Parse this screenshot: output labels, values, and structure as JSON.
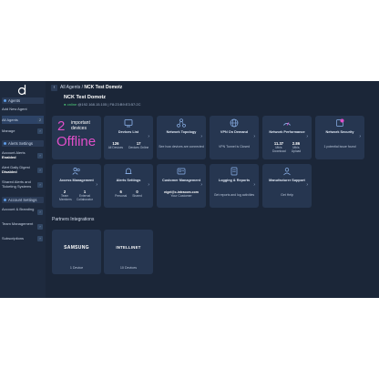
{
  "breadcrumb": {
    "parent": "All Agents",
    "current": "NCK Test Domotz"
  },
  "agent": {
    "name": "NCK Test Domotz",
    "status": "online",
    "details": "@192.168.15.105 | F8:23:B9:E3:57:2C"
  },
  "sidebar": {
    "agents_title": "Agents",
    "add_agent": "Add New Agent",
    "all_agents": "All Agents",
    "all_agents_count": "2",
    "manage": "Manage",
    "alerts_title": "Alerts Settings",
    "account_alerts": "Account Alerts",
    "account_alerts_state": "Enabled",
    "alert_digest": "Alert Daily Digest",
    "alert_digest_state": "Disabled",
    "shared_alerts": "Shared Alerts and Ticketing Systems",
    "account_title": "Account Settings",
    "account_branding": "Account & Branding",
    "team_mgmt": "Team Management",
    "subscriptions": "Subscriptions"
  },
  "offline": {
    "count": "2",
    "label": "important devices",
    "status": "Offline"
  },
  "cards": {
    "devices": {
      "title": "Devices List",
      "all_value": "126",
      "all_label": "All Devices",
      "online_value": "17",
      "online_label": "Devices Online"
    },
    "topology": {
      "title": "Network Topology",
      "sub": "See how devices are connected"
    },
    "vpn": {
      "title": "VPN On Demand",
      "sub": "VPN Tunnel is Closed"
    },
    "performance": {
      "title": "Network Performance",
      "down_value": "11.37",
      "down_label": "Mb/s Download",
      "up_value": "2.86",
      "up_label": "Mb/s Upload"
    },
    "security": {
      "title": "Network Security",
      "sub": "1 potential issue found"
    },
    "access": {
      "title": "Access Management",
      "team_value": "2",
      "team_label": "Team Members",
      "ext_value": "1",
      "ext_label": "External Collaborator"
    },
    "alerts": {
      "title": "Alerts Settings",
      "personal_value": "6",
      "personal_label": "Personal",
      "shared_value": "0",
      "shared_label": "Shared"
    },
    "customer": {
      "title": "Customer Management",
      "email": "nigel@c-intracom.com",
      "sub": "Your Customer"
    },
    "logging": {
      "title": "Logging & Reports",
      "sub": "Get reports and log activities"
    },
    "support": {
      "title": "Manufacturer Support",
      "sub": "Get Help"
    }
  },
  "partners": {
    "title": "Partners Integrations",
    "items": [
      {
        "logo": "SAMSUNG",
        "count": "1 Device"
      },
      {
        "logo": "INTELLINET",
        "count": "10 Devices"
      }
    ]
  },
  "colors": {
    "background": "#1b2638",
    "card": "#263650",
    "accent": "#e04fc9",
    "online": "#4fcf7a"
  }
}
